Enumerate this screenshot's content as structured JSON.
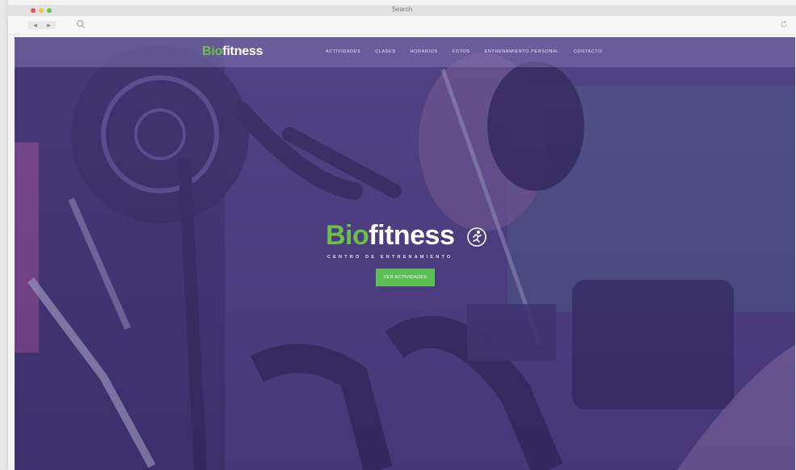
{
  "browser": {
    "title": "Search",
    "nav_back": "◀",
    "nav_forward": "▶",
    "icons": [
      "search-icon",
      "reload-icon"
    ]
  },
  "site": {
    "brand_prefix": "Bio",
    "brand_suffix": "fitness",
    "menu": [
      "ACTIVIDADES",
      "CLASES",
      "HORARIOS",
      "FOTOS",
      "ENTRENAMIENTO PERSONAL",
      "CONTACTO"
    ]
  },
  "hero": {
    "title_prefix": "Bio",
    "title_suffix": "fitness",
    "subtitle": "CENTRO DE ENTRENAMIENTO",
    "cta_label": "VER ACTIVIDADES"
  },
  "colors": {
    "brand_green": "#6cc04a",
    "button_green": "#5cbf55",
    "overlay_purple": "#5c4a96"
  }
}
